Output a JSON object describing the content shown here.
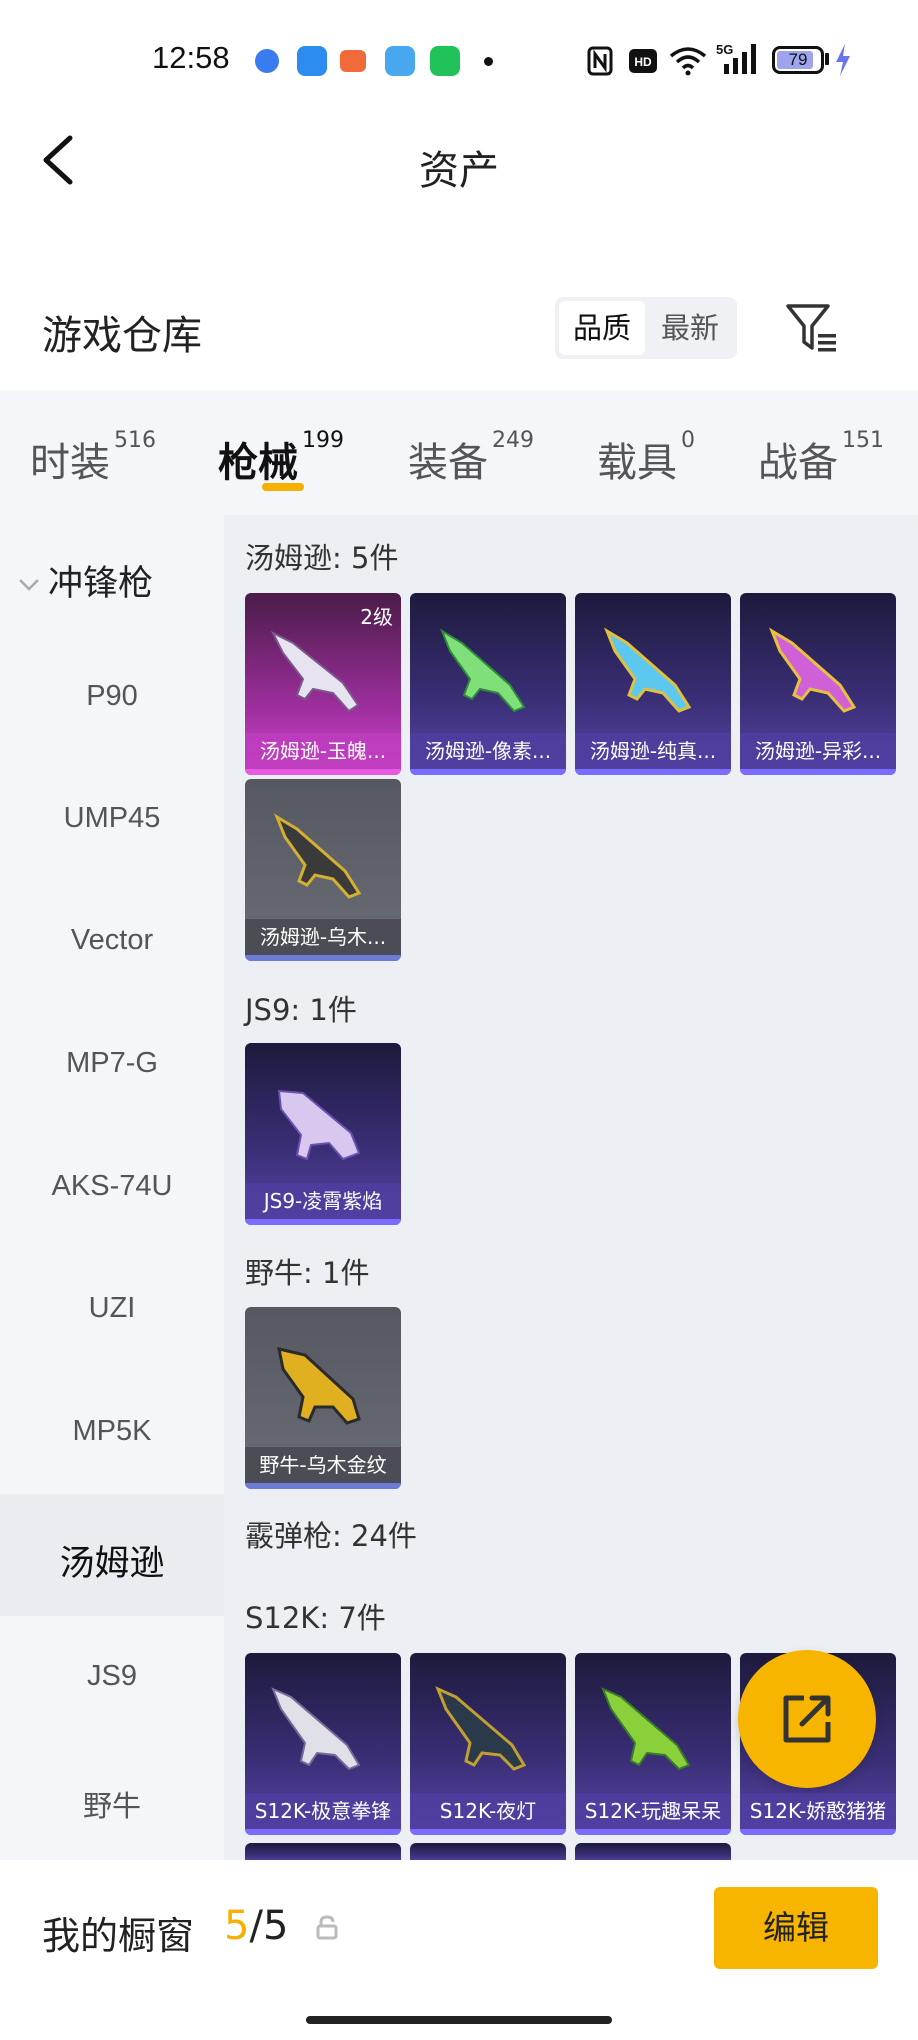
{
  "status_bar": {
    "time": "12:58",
    "battery": "79",
    "network": "5G"
  },
  "header": {
    "title": "资产"
  },
  "section": {
    "title": "游戏仓库",
    "sort_options": [
      "品质",
      "最新"
    ],
    "sort_selected": "品质"
  },
  "tabs": [
    {
      "label": "时装",
      "count": "516"
    },
    {
      "label": "枪械",
      "count": "199"
    },
    {
      "label": "装备",
      "count": "249"
    },
    {
      "label": "载具",
      "count": "0"
    },
    {
      "label": "战备",
      "count": "151"
    }
  ],
  "sidebar": {
    "category": "冲锋枪",
    "items": [
      "P90",
      "UMP45",
      "Vector",
      "MP7-G",
      "AKS-74U",
      "UZI",
      "MP5K",
      "汤姆逊",
      "JS9",
      "野牛"
    ],
    "selected": "汤姆逊"
  },
  "groups": {
    "thompson": {
      "label": "汤姆逊: 5件",
      "items": [
        {
          "name": "汤姆逊-玉魄...",
          "level": "2级",
          "rarity": "pink"
        },
        {
          "name": "汤姆逊-像素...",
          "rarity": "purple"
        },
        {
          "name": "汤姆逊-纯真...",
          "rarity": "purple"
        },
        {
          "name": "汤姆逊-异彩...",
          "rarity": "purple"
        },
        {
          "name": "汤姆逊-乌木...",
          "rarity": "gray"
        }
      ]
    },
    "js9": {
      "label": "JS9: 1件",
      "items": [
        {
          "name": "JS9-凌霄紫焰",
          "rarity": "purple"
        }
      ]
    },
    "bison": {
      "label": "野牛: 1件",
      "items": [
        {
          "name": "野牛-乌木金纹",
          "rarity": "gray"
        }
      ]
    },
    "shotgun": {
      "label": "霰弹枪: 24件"
    },
    "s12k": {
      "label": "S12K: 7件",
      "items": [
        {
          "name": "S12K-极意拳锋",
          "rarity": "purple"
        },
        {
          "name": "S12K-夜灯",
          "rarity": "purple"
        },
        {
          "name": "S12K-玩趣呆呆",
          "rarity": "purple"
        },
        {
          "name": "S12K-娇憨猪猪",
          "rarity": "purple"
        }
      ]
    }
  },
  "bottom_bar": {
    "title": "我的橱窗",
    "count_current": "5",
    "count_sep": "/",
    "count_total": "5",
    "edit_label": "编辑"
  },
  "colors": {
    "accent": "#f7b500",
    "purple_rarity": "#7a6cff",
    "pink_rarity": "#e85ae4"
  }
}
